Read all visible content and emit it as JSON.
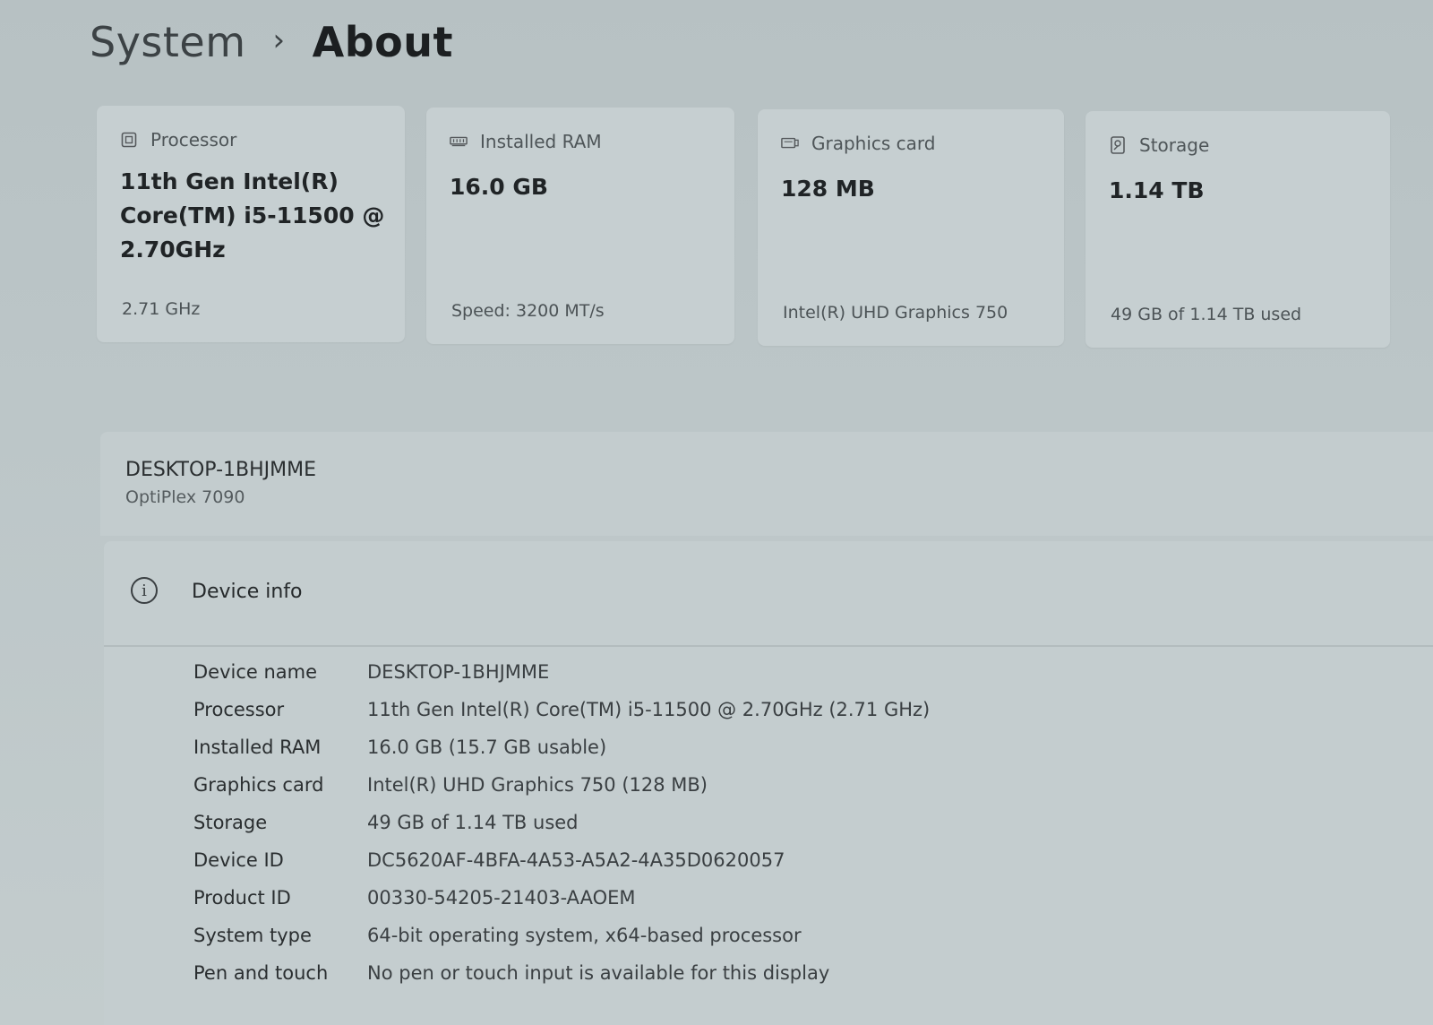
{
  "breadcrumb": {
    "parent": "System",
    "separator": "›",
    "current": "About"
  },
  "cards": [
    {
      "icon": "processor-icon",
      "label": "Processor",
      "value": "11th Gen Intel(R) Core(TM) i5-11500 @ 2.70GHz",
      "sub": "2.71 GHz"
    },
    {
      "icon": "ram-icon",
      "label": "Installed RAM",
      "value": "16.0 GB",
      "sub": "Speed: 3200 MT/s"
    },
    {
      "icon": "graphics-card-icon",
      "label": "Graphics card",
      "value": "128 MB",
      "sub": "Intel(R) UHD Graphics 750"
    },
    {
      "icon": "storage-icon",
      "label": "Storage",
      "value": "1.14 TB",
      "sub": "49 GB of 1.14 TB used"
    }
  ],
  "device": {
    "name": "DESKTOP-1BHJMME",
    "model": "OptiPlex 7090"
  },
  "device_info": {
    "title": "Device info",
    "rows": [
      {
        "label": "Device name",
        "value": "DESKTOP-1BHJMME"
      },
      {
        "label": "Processor",
        "value": "11th Gen Intel(R) Core(TM) i5-11500 @ 2.70GHz (2.71 GHz)"
      },
      {
        "label": "Installed RAM",
        "value": "16.0 GB (15.7 GB usable)"
      },
      {
        "label": "Graphics card",
        "value": "Intel(R) UHD Graphics 750 (128 MB)"
      },
      {
        "label": "Storage",
        "value": "49 GB of 1.14 TB used"
      },
      {
        "label": "Device ID",
        "value": "DC5620AF-4BFA-4A53-A5A2-4A35D0620057"
      },
      {
        "label": "Product ID",
        "value": "00330-54205-21403-AAOEM"
      },
      {
        "label": "System type",
        "value": "64-bit operating system, x64-based processor"
      },
      {
        "label": "Pen and touch",
        "value": "No pen or touch input is available for this display"
      }
    ]
  }
}
